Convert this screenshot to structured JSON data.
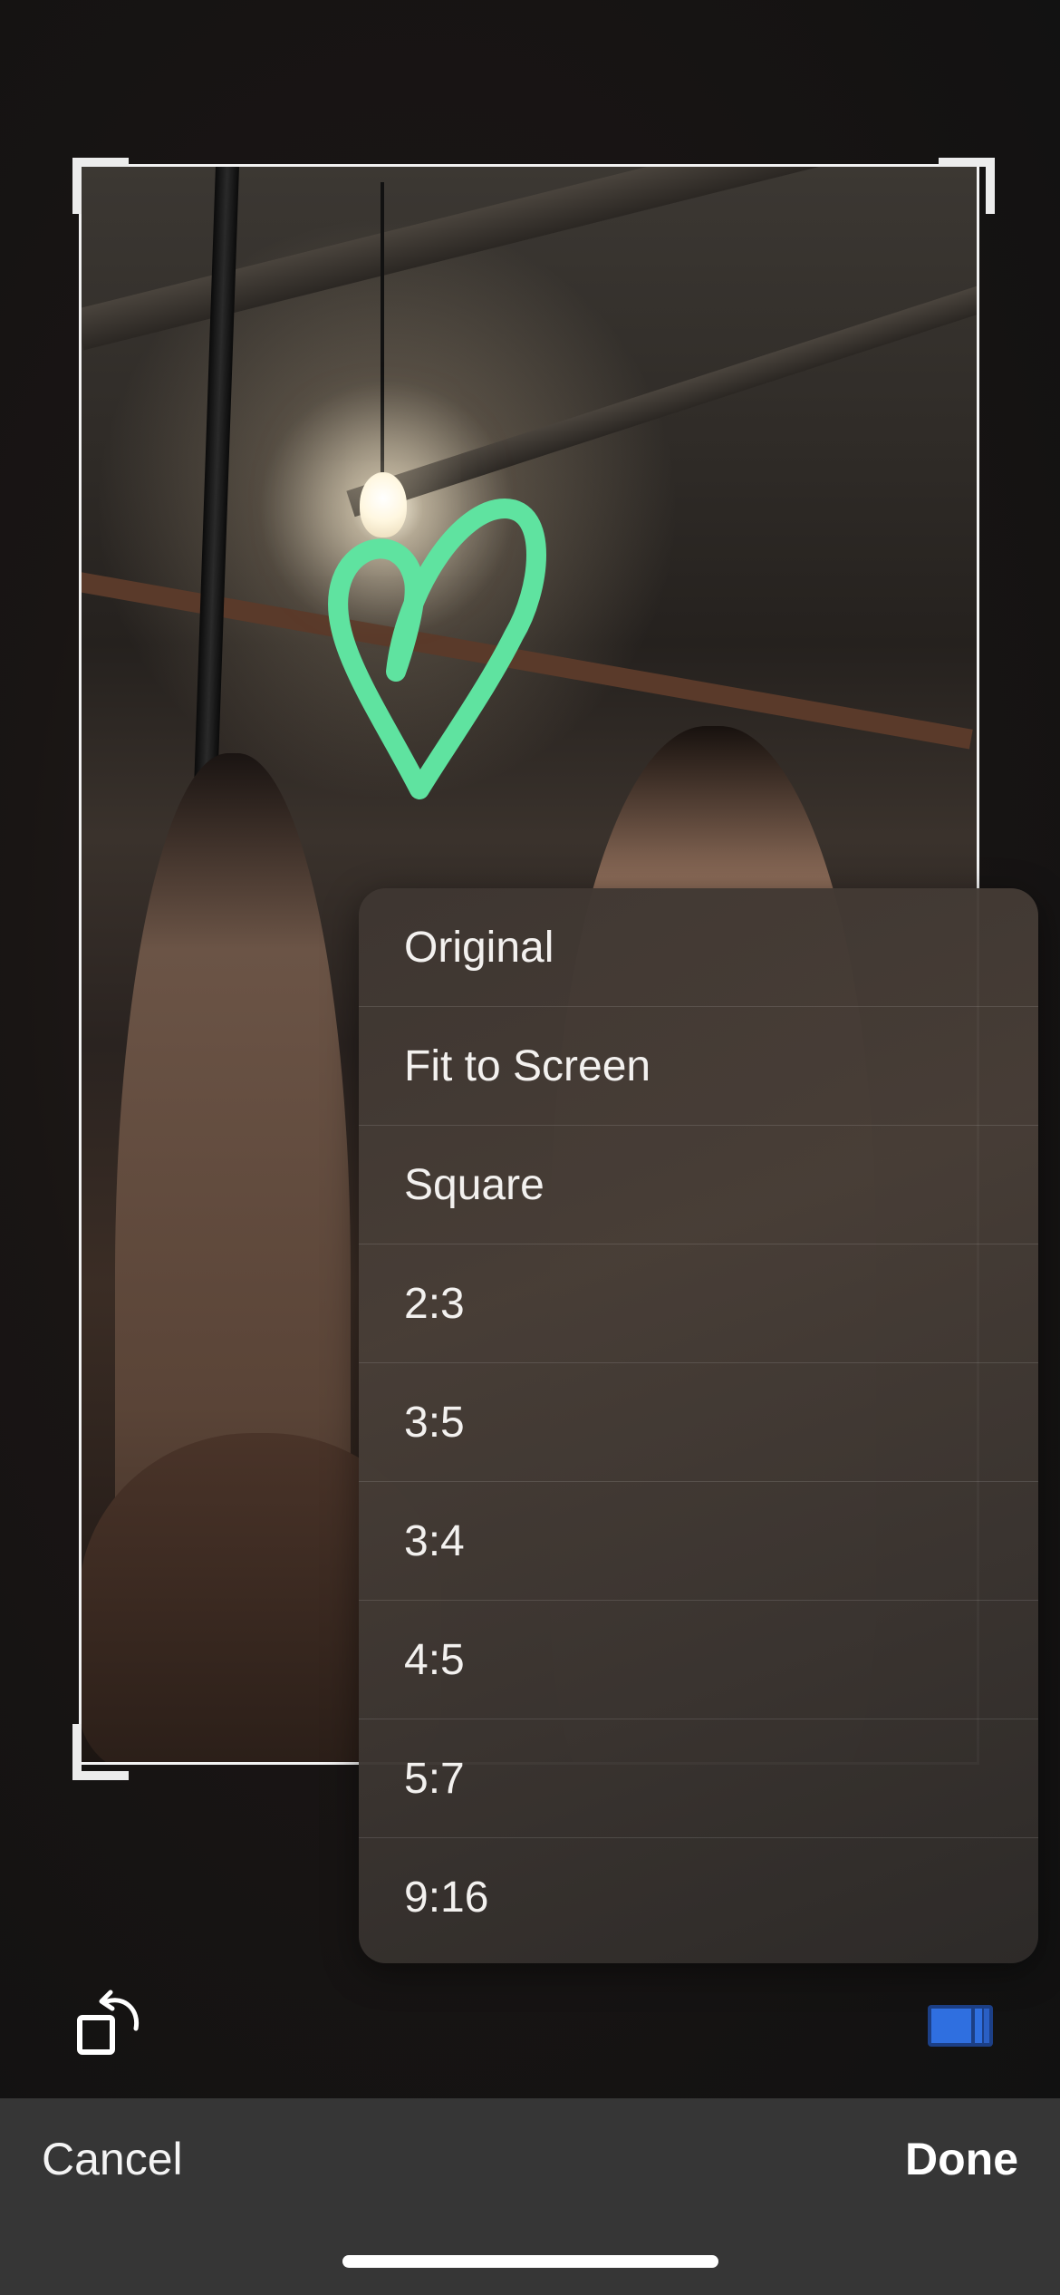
{
  "aspect_menu": {
    "items": [
      {
        "label": "Original"
      },
      {
        "label": "Fit to Screen"
      },
      {
        "label": "Square"
      },
      {
        "label": "2:3"
      },
      {
        "label": "3:5"
      },
      {
        "label": "3:4"
      },
      {
        "label": "4:5"
      },
      {
        "label": "5:7"
      },
      {
        "label": "9:16"
      }
    ]
  },
  "toolbar": {
    "rotate_icon": "rotate-left-icon",
    "aspect_icon": "aspect-ratio-icon",
    "aspect_icon_color": "#2f6fe0"
  },
  "bottom_bar": {
    "cancel_label": "Cancel",
    "done_label": "Done"
  },
  "markup": {
    "heart_color": "#5fe3a0"
  }
}
